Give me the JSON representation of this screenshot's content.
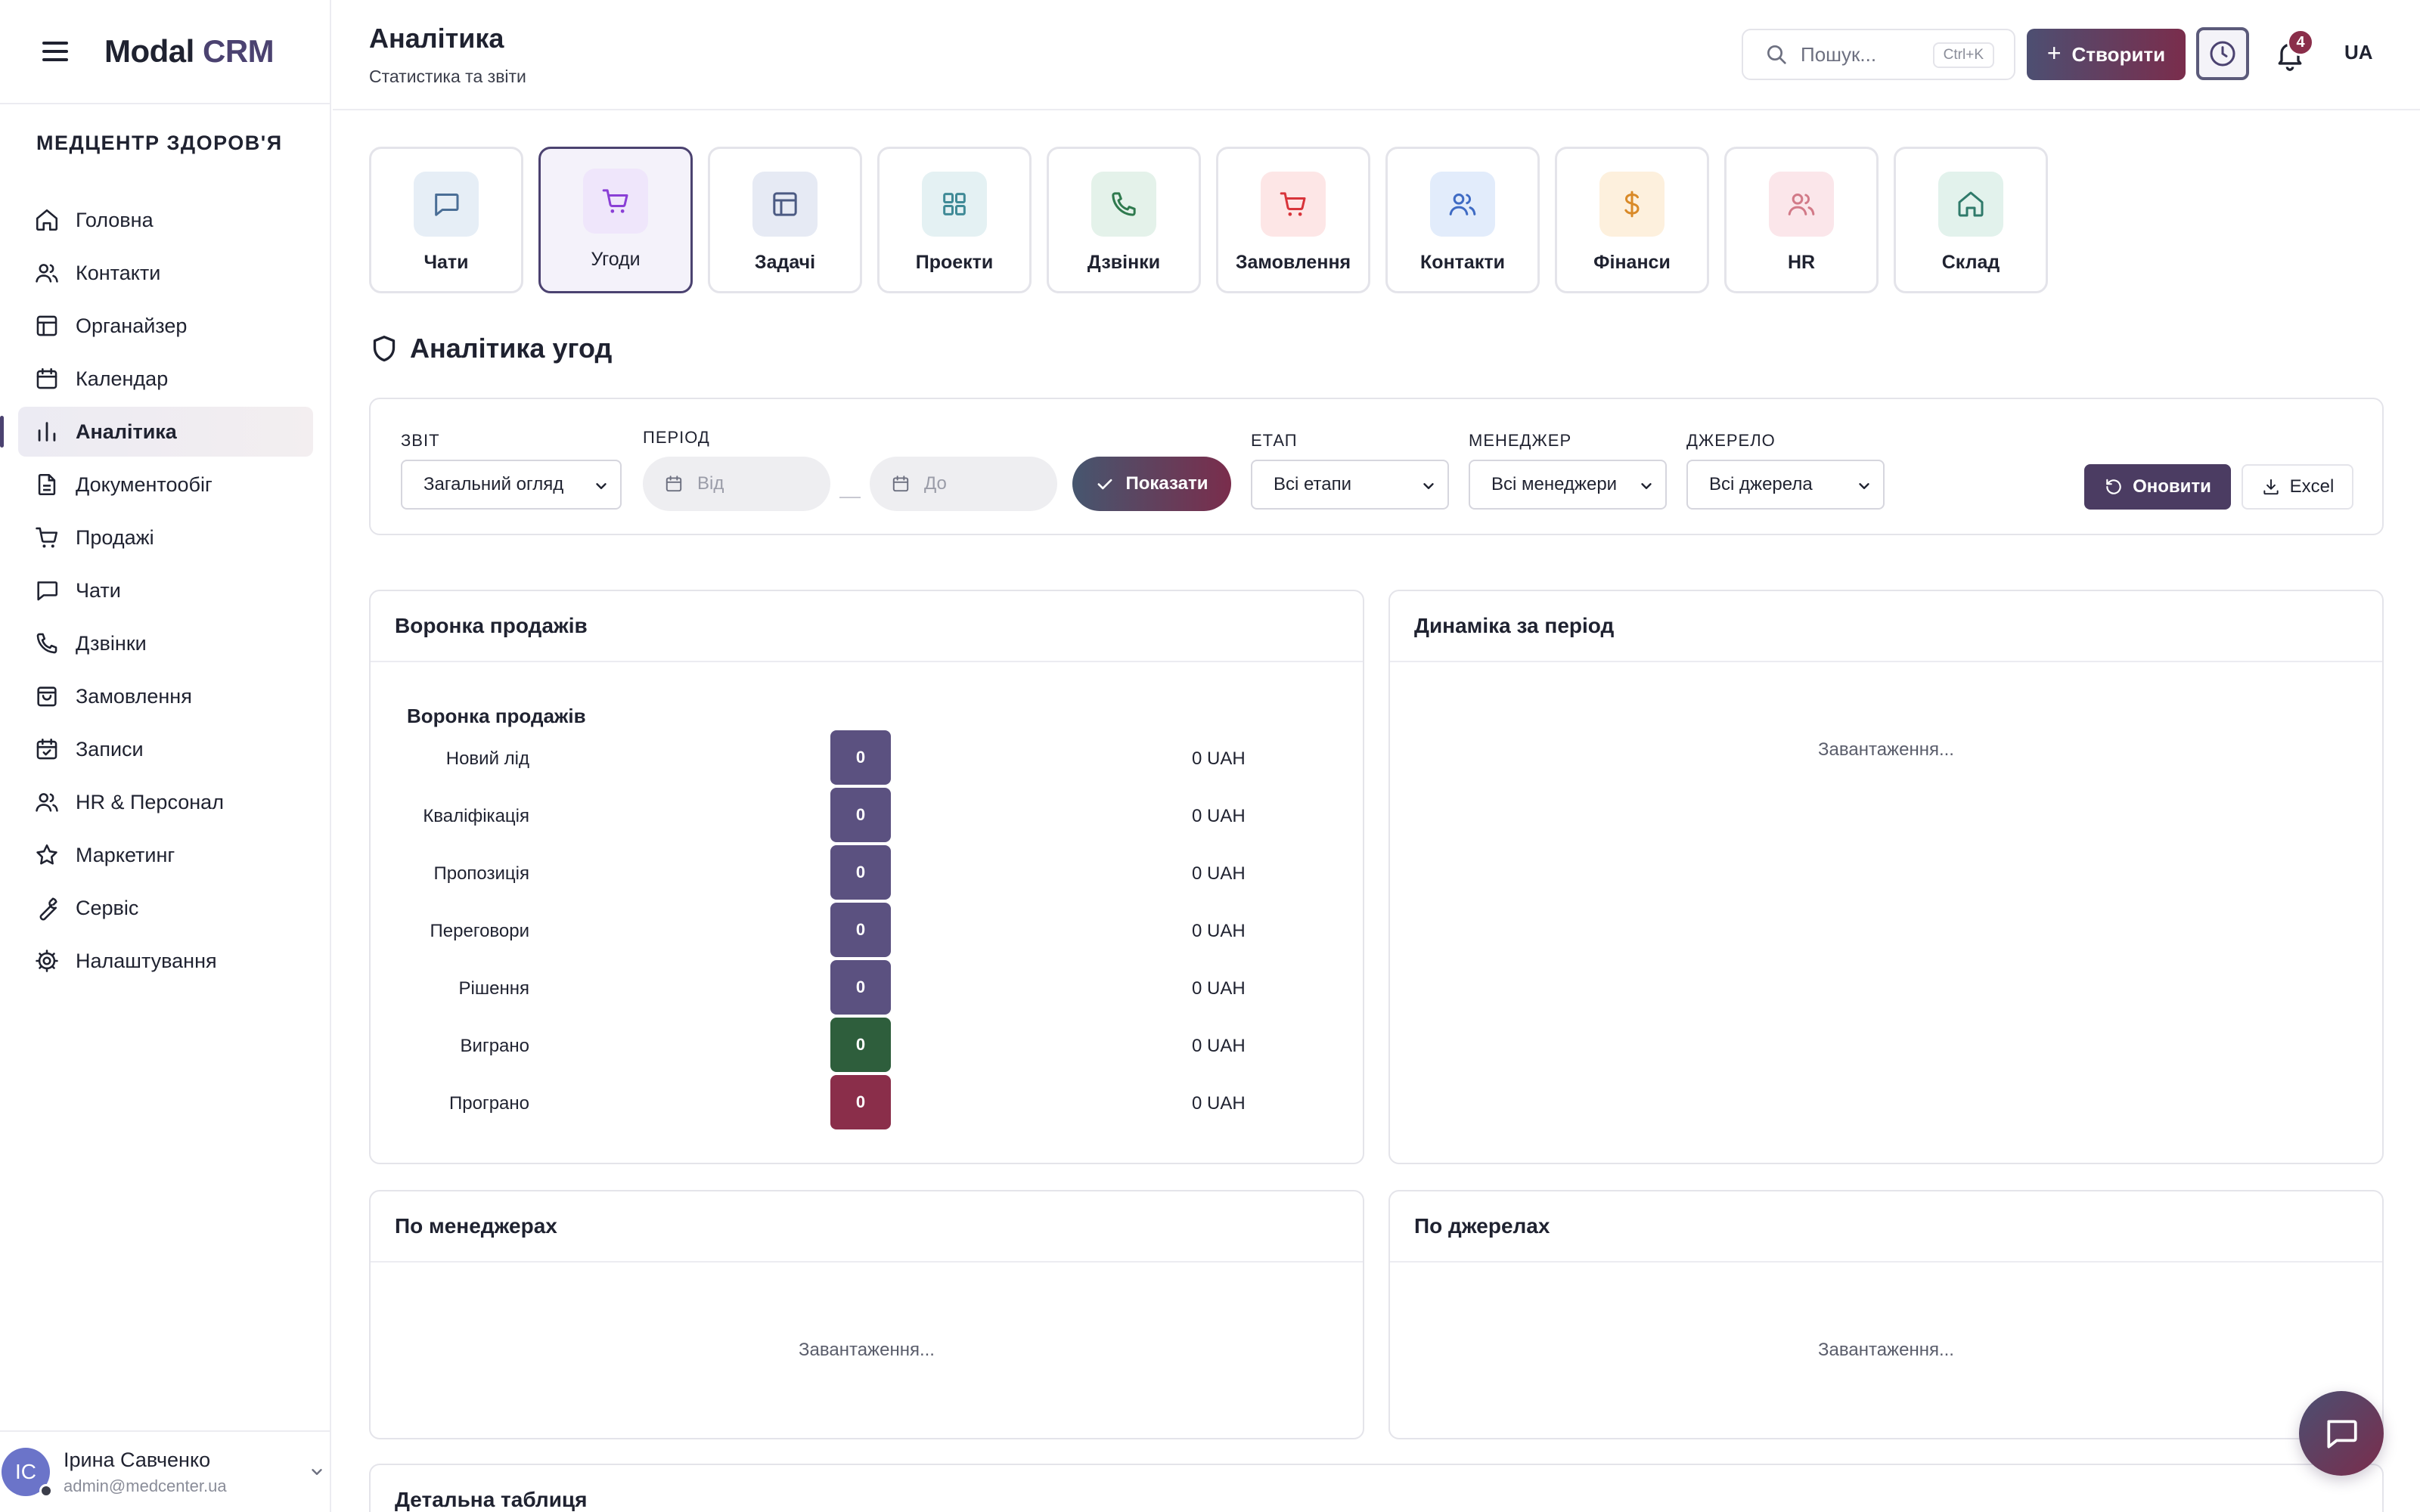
{
  "app": {
    "logo_main": "Modal",
    "logo_accent": "CRM",
    "org_name": "МЕДЦЕНТР ЗДОРОВ'Я"
  },
  "sidebar": {
    "items": [
      {
        "label": "Головна",
        "icon": "home-icon"
      },
      {
        "label": "Контакти",
        "icon": "users-icon"
      },
      {
        "label": "Органайзер",
        "icon": "layout-icon"
      },
      {
        "label": "Календар",
        "icon": "calendar-icon"
      },
      {
        "label": "Аналітика",
        "icon": "bar-chart-icon",
        "active": true
      },
      {
        "label": "Документообіг",
        "icon": "file-icon"
      },
      {
        "label": "Продажі",
        "icon": "cart-icon"
      },
      {
        "label": "Чати",
        "icon": "chat-icon"
      },
      {
        "label": "Дзвінки",
        "icon": "phone-icon"
      },
      {
        "label": "Замовлення",
        "icon": "bag-icon"
      },
      {
        "label": "Записи",
        "icon": "calendar-check-icon"
      },
      {
        "label": "HR & Персонал",
        "icon": "users-icon"
      },
      {
        "label": "Маркетинг",
        "icon": "star-icon"
      },
      {
        "label": "Сервіс",
        "icon": "wrench-icon"
      },
      {
        "label": "Налаштування",
        "icon": "gear-icon"
      }
    ],
    "user": {
      "initials": "IC",
      "name": "Ірина Савченко",
      "email": "admin@medcenter.ua"
    }
  },
  "header": {
    "title": "Аналітика",
    "subtitle": "Статистика та звіти",
    "search_placeholder": "Пошук...",
    "search_shortcut": "Ctrl+K",
    "create_label": "Створити",
    "notifications_count": "4",
    "lang": "UA"
  },
  "modules": [
    {
      "label": "Чати",
      "icon": "chat-icon",
      "bg": "#e6eef6",
      "color": "#4a6e96"
    },
    {
      "label": "Угоди",
      "icon": "cart-icon",
      "bg": "#efe6fb",
      "color": "#8a3fd6",
      "active": true
    },
    {
      "label": "Задачі",
      "icon": "layout-icon",
      "bg": "#e6eaf4",
      "color": "#4b5a82"
    },
    {
      "label": "Проекти",
      "icon": "grid-icon",
      "bg": "#e4f1f3",
      "color": "#3f8a96"
    },
    {
      "label": "Дзвінки",
      "icon": "phone-icon",
      "bg": "#e4f2ea",
      "color": "#2f7a4e"
    },
    {
      "label": "Замовлення",
      "icon": "cart-icon",
      "bg": "#fde6e6",
      "color": "#d8343a"
    },
    {
      "label": "Контакти",
      "icon": "users-icon",
      "bg": "#e2ecfb",
      "color": "#3f6bc4"
    },
    {
      "label": "Фінанси",
      "icon": "dollar-icon",
      "bg": "#fdf0dd",
      "color": "#d98a28"
    },
    {
      "label": "HR",
      "icon": "users-icon",
      "bg": "#fbe6ea",
      "color": "#d27a88"
    },
    {
      "label": "Склад",
      "icon": "home-icon",
      "bg": "#e2f2ec",
      "color": "#2f7a6a"
    }
  ],
  "section_title": "Аналітика угод",
  "filters": {
    "report_label": "ЗВІТ",
    "report_value": "Загальний огляд",
    "period_label": "ПЕРІОД",
    "from_placeholder": "Від",
    "to_placeholder": "До",
    "show_label": "Показати",
    "stage_label": "ЕТАП",
    "stage_value": "Всі етапи",
    "manager_label": "МЕНЕДЖЕР",
    "manager_value": "Всі менеджери",
    "source_label": "ДЖЕРЕЛО",
    "source_value": "Всі джерела",
    "refresh_label": "Оновити",
    "excel_label": "Excel"
  },
  "panels": {
    "funnel": {
      "title": "Воронка продажів",
      "inner_title": "Воронка продажів",
      "rows": [
        {
          "name": "Новий лід",
          "count": "0",
          "amount": "0 UAH",
          "color": "#5b5180"
        },
        {
          "name": "Кваліфікація",
          "count": "0",
          "amount": "0 UAH",
          "color": "#5b5180"
        },
        {
          "name": "Пропозиція",
          "count": "0",
          "amount": "0 UAH",
          "color": "#5b5180"
        },
        {
          "name": "Переговори",
          "count": "0",
          "amount": "0 UAH",
          "color": "#5b5180"
        },
        {
          "name": "Рішення",
          "count": "0",
          "amount": "0 UAH",
          "color": "#5b5180"
        },
        {
          "name": "Виграно",
          "count": "0",
          "amount": "0 UAH",
          "color": "#2e5e3c"
        },
        {
          "name": "Програно",
          "count": "0",
          "amount": "0 UAH",
          "color": "#8a2e4a"
        }
      ]
    },
    "dynamics": {
      "title": "Динаміка за період",
      "loading": "Завантаження..."
    },
    "managers": {
      "title": "По менеджерах",
      "loading": "Завантаження..."
    },
    "sources": {
      "title": "По джерелах",
      "loading": "Завантаження..."
    },
    "detail": {
      "title": "Детальна таблиця"
    }
  }
}
